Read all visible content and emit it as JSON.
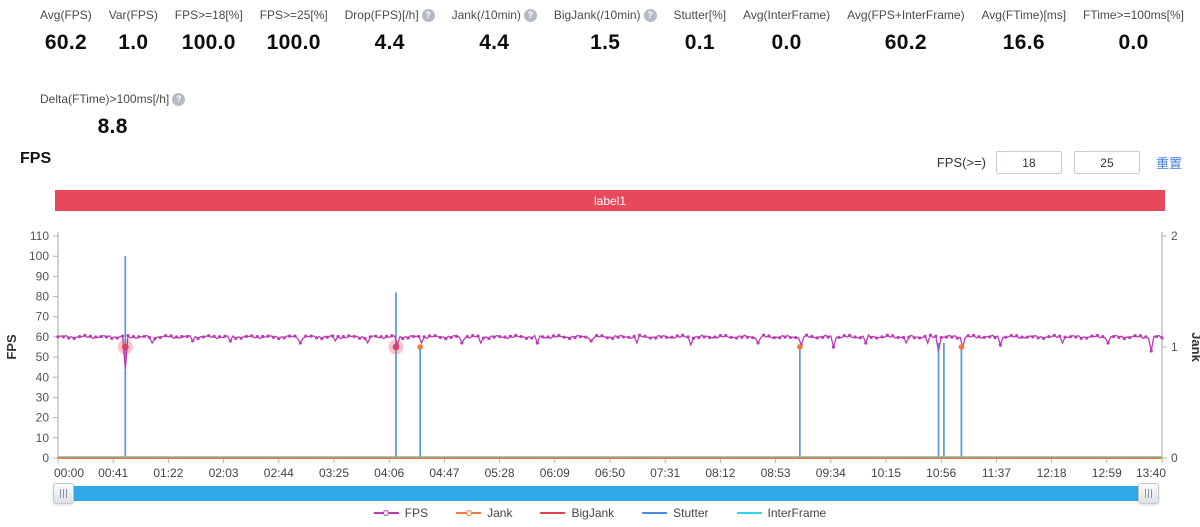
{
  "metrics": {
    "help_icon_glyph": "?",
    "row1": [
      {
        "label": "Avg(FPS)",
        "value": "60.2",
        "help": false
      },
      {
        "label": "Var(FPS)",
        "value": "1.0",
        "help": false
      },
      {
        "label": "FPS>=18[%]",
        "value": "100.0",
        "help": false
      },
      {
        "label": "FPS>=25[%]",
        "value": "100.0",
        "help": false
      },
      {
        "label": "Drop(FPS)[/h]",
        "value": "4.4",
        "help": true
      },
      {
        "label": "Jank(/10min)",
        "value": "4.4",
        "help": true
      },
      {
        "label": "BigJank(/10min)",
        "value": "1.5",
        "help": true
      },
      {
        "label": "Stutter[%]",
        "value": "0.1",
        "help": false
      },
      {
        "label": "Avg(InterFrame)",
        "value": "0.0",
        "help": false
      },
      {
        "label": "Avg(FPS+InterFrame)",
        "value": "60.2",
        "help": false
      },
      {
        "label": "Avg(FTime)[ms]",
        "value": "16.6",
        "help": false
      },
      {
        "label": "FTime>=100ms[%]",
        "value": "0.0",
        "help": false
      }
    ],
    "row2": [
      {
        "label": "Delta(FTime)>100ms[/h]",
        "value": "8.8",
        "help": true
      }
    ]
  },
  "section": {
    "title": "FPS"
  },
  "filter": {
    "label": "FPS(>=)",
    "low": "18",
    "high": "25",
    "reset_label": "重置"
  },
  "banner": {
    "text": "label1",
    "color": "#e8495a"
  },
  "chart_data": {
    "type": "line",
    "x_axis": {
      "ticks": [
        "00:00",
        "00:41",
        "01:22",
        "02:03",
        "02:44",
        "03:25",
        "04:06",
        "04:47",
        "05:28",
        "06:09",
        "06:50",
        "07:31",
        "08:12",
        "08:53",
        "09:34",
        "10:15",
        "10:56",
        "11:37",
        "12:18",
        "12:59",
        "13:40"
      ],
      "duration_s": 820
    },
    "y_left": {
      "label": "FPS",
      "min": 0,
      "max": 110,
      "step": 10
    },
    "y_right": {
      "label": "Jank",
      "min": 0,
      "max": 2,
      "step": 1
    },
    "grid": false,
    "series": [
      {
        "name": "FPS",
        "color": "#bb3cb5",
        "axis": "left",
        "baseline": 60,
        "noise": 0.9,
        "dips": [
          {
            "t": 50,
            "v": 44
          },
          {
            "t": 70,
            "v": 57
          },
          {
            "t": 100,
            "v": 58
          },
          {
            "t": 128,
            "v": 58
          },
          {
            "t": 180,
            "v": 57
          },
          {
            "t": 205,
            "v": 58
          },
          {
            "t": 230,
            "v": 57
          },
          {
            "t": 251,
            "v": 56
          },
          {
            "t": 269,
            "v": 57
          },
          {
            "t": 300,
            "v": 57
          },
          {
            "t": 313,
            "v": 57
          },
          {
            "t": 355,
            "v": 57
          },
          {
            "t": 395,
            "v": 58
          },
          {
            "t": 430,
            "v": 57
          },
          {
            "t": 470,
            "v": 56
          },
          {
            "t": 520,
            "v": 57
          },
          {
            "t": 551,
            "v": 56
          },
          {
            "t": 575,
            "v": 55
          },
          {
            "t": 600,
            "v": 57
          },
          {
            "t": 630,
            "v": 57
          },
          {
            "t": 645,
            "v": 57
          },
          {
            "t": 654,
            "v": 53
          },
          {
            "t": 671,
            "v": 55
          },
          {
            "t": 700,
            "v": 56
          },
          {
            "t": 745,
            "v": 57
          },
          {
            "t": 780,
            "v": 57
          },
          {
            "t": 812,
            "v": 53
          }
        ]
      },
      {
        "name": "Jank",
        "color": "#f4793b",
        "axis": "right",
        "baseline": 0,
        "events": [
          {
            "t": 269,
            "v": 1
          },
          {
            "t": 551,
            "v": 1
          },
          {
            "t": 671,
            "v": 1
          }
        ]
      },
      {
        "name": "BigJank",
        "color": "#e5404e",
        "axis": "right",
        "events": [
          {
            "t": 50,
            "v": 1
          },
          {
            "t": 251,
            "v": 1
          }
        ]
      },
      {
        "name": "Stutter",
        "color": "#4d8be1",
        "axis": "left",
        "spikes": [
          {
            "t": 50,
            "v": 100
          },
          {
            "t": 251,
            "v": 82
          },
          {
            "t": 269,
            "v": 55
          },
          {
            "t": 551,
            "v": 55
          },
          {
            "t": 654,
            "v": 57
          },
          {
            "t": 658,
            "v": 57
          },
          {
            "t": 671,
            "v": 55
          }
        ]
      },
      {
        "name": "InterFrame",
        "color": "#2fd5e8",
        "axis": "left",
        "baseline": 0
      }
    ]
  },
  "legend": [
    {
      "name": "FPS",
      "color": "#bb3cb5",
      "marker": "line-circle"
    },
    {
      "name": "Jank",
      "color": "#f4793b",
      "marker": "line-circle"
    },
    {
      "name": "BigJank",
      "color": "#e5404e",
      "marker": "line"
    },
    {
      "name": "Stutter",
      "color": "#4d8be1",
      "marker": "line"
    },
    {
      "name": "InterFrame",
      "color": "#2fd5e8",
      "marker": "line"
    }
  ],
  "scrollbar": {
    "color": "#2fa9e9"
  }
}
